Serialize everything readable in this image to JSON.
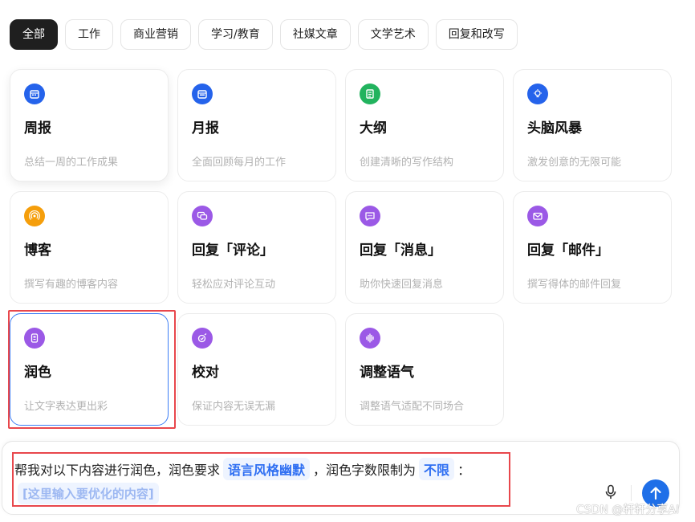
{
  "tabs": [
    {
      "label": "全部",
      "active": true
    },
    {
      "label": "工作",
      "active": false
    },
    {
      "label": "商业营销",
      "active": false
    },
    {
      "label": "学习/教育",
      "active": false
    },
    {
      "label": "社媒文章",
      "active": false
    },
    {
      "label": "文学艺术",
      "active": false
    },
    {
      "label": "回复和改写",
      "active": false
    }
  ],
  "cards": [
    {
      "title": "周报",
      "desc": "总结一周的工作成果",
      "icon": "calendar-icon",
      "color": "#2563eb"
    },
    {
      "title": "月报",
      "desc": "全面回顾每月的工作",
      "icon": "calendar-icon",
      "color": "#2563eb"
    },
    {
      "title": "大纲",
      "desc": "创建清晰的写作结构",
      "icon": "outline-icon",
      "color": "#22b35e"
    },
    {
      "title": "头脑风暴",
      "desc": "激发创意的无限可能",
      "icon": "lightbulb-icon",
      "color": "#2563eb"
    },
    {
      "title": "博客",
      "desc": "撰写有趣的博客内容",
      "icon": "broadcast-icon",
      "color": "#f59e0b"
    },
    {
      "title": "回复「评论」",
      "desc": "轻松应对评论互动",
      "icon": "comment-icon",
      "color": "#9b59e6"
    },
    {
      "title": "回复「消息」",
      "desc": "助你快速回复消息",
      "icon": "message-icon",
      "color": "#9b59e6"
    },
    {
      "title": "回复「邮件」",
      "desc": "撰写得体的邮件回复",
      "icon": "mail-icon",
      "color": "#9b59e6"
    },
    {
      "title": "润色",
      "desc": "让文字表达更出彩",
      "icon": "polish-icon",
      "color": "#9b59e6"
    },
    {
      "title": "校对",
      "desc": "保证内容无误无漏",
      "icon": "proofread-icon",
      "color": "#9b59e6"
    },
    {
      "title": "调整语气",
      "desc": "调整语气适配不同场合",
      "icon": "soundwave-icon",
      "color": "#9b59e6"
    }
  ],
  "input": {
    "prefix": "帮我对以下内容进行润色，润色要求",
    "style_chip": "语言风格幽默",
    "middle": "，润色字数限制为",
    "limit_chip": "不限",
    "suffix": "：",
    "content_placeholder": "[这里输入要优化的内容]"
  },
  "watermark": "CSDN @轩轩分享AI",
  "colors": {
    "accent": "#1f6fe8",
    "highlight": "#e8474c"
  }
}
